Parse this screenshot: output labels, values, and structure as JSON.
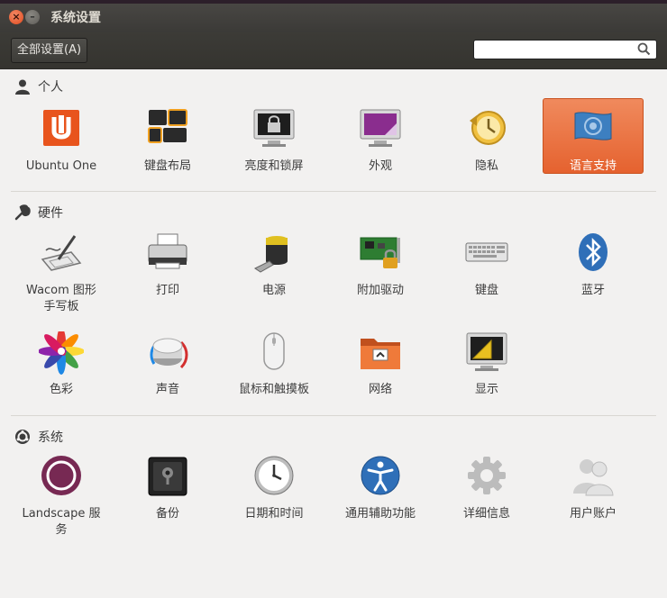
{
  "window": {
    "title": "系统设置"
  },
  "toolbar": {
    "all_settings": "全部设置(A)",
    "search_placeholder": ""
  },
  "sections": {
    "personal": {
      "title": "个人",
      "items": [
        "Ubuntu One",
        "键盘布局",
        "亮度和锁屏",
        "外观",
        "隐私",
        "语言支持"
      ]
    },
    "hardware": {
      "title": "硬件",
      "items": [
        "Wacom 图形\n手写板",
        "打印",
        "电源",
        "附加驱动",
        "键盘",
        "蓝牙",
        "色彩",
        "声音",
        "鼠标和触摸板",
        "网络",
        "显示"
      ]
    },
    "system": {
      "title": "系统",
      "items": [
        "Landscape 服务",
        "备份",
        "日期和时间",
        "通用辅助功能",
        "详细信息",
        "用户账户"
      ]
    }
  },
  "selected_item": "语言支持",
  "colors": {
    "accent": "#e96a35",
    "titlebar": "#3c3b37",
    "background": "#f2f1f0"
  }
}
